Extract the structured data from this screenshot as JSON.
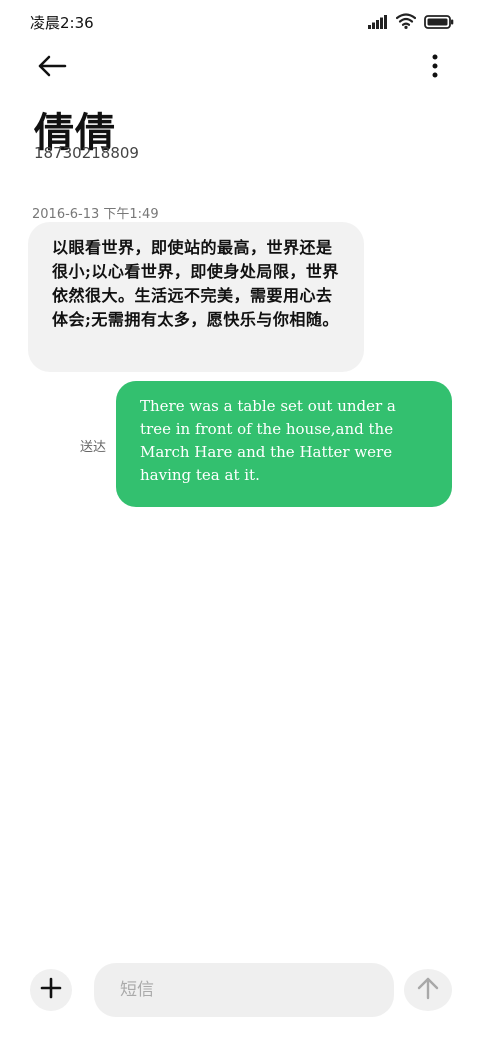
{
  "status_bar": {
    "time": "凌晨2:36",
    "icons": [
      "signal-icon",
      "wifi-icon",
      "battery-icon"
    ]
  },
  "header": {
    "back_icon": "back-arrow-icon",
    "more_icon": "more-vertical-icon",
    "contact_name": "倩倩",
    "contact_number": "18730218809"
  },
  "conversation": {
    "timestamp": "2016-6-13 下午1:49",
    "incoming_message": "以眼看世界，即使站的最高，世界还是很小;以心看世界，即使身处局限，世界依然很大。生活远不完美，需要用心去体会;无需拥有太多，愿快乐与你相随。",
    "outgoing_message": "There was a table set out under a tree in front of the house,and the March Hare and the Hatter were having tea at it.",
    "outgoing_status": "送达"
  },
  "composer": {
    "add_icon": "plus-icon",
    "placeholder": "短信",
    "value": "",
    "send_icon": "send-arrow-up-icon"
  },
  "colors": {
    "outgoing_bubble": "#33c06f",
    "incoming_bubble": "#f2f2f2"
  }
}
